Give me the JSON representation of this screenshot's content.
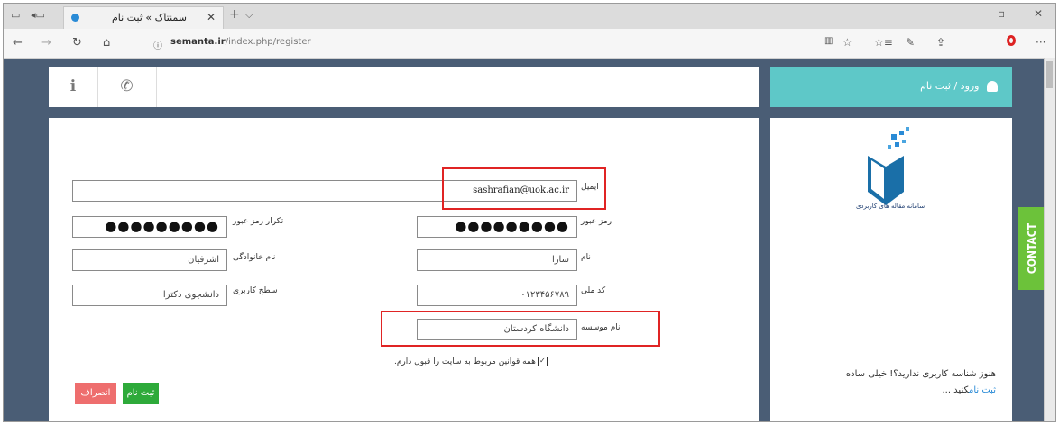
{
  "browser": {
    "tab_title": "سمنتاک » ثبت نام",
    "url_domain": "semanta.ir",
    "url_path": "/index.php/register"
  },
  "header": {
    "login_label": "ورود / ثبت نام"
  },
  "form": {
    "email_label": "ایمیل",
    "email_value": "sashrafian@uok.ac.ir",
    "password_label": "رمز عبور",
    "password_value": "●●●●●●●●●",
    "password_confirm_label": "تکرار رمز عبور",
    "password_confirm_value": "●●●●●●●●●",
    "first_name_label": "نام",
    "first_name_value": "سارا",
    "last_name_label": "نام خانوادگی",
    "last_name_value": "اشرفیان",
    "national_id_label": "کد ملی",
    "national_id_value": "۰۱۲۳۴۵۶۷۸۹",
    "user_level_label": "سطح کاربری",
    "user_level_value": "دانشجوی دکترا",
    "institution_label": "نام موسسه",
    "institution_value": "دانشگاه کردستان",
    "terms_label": "همه قوانین مربوط به سایت را قبول دارم.",
    "submit_label": "ثبت نام",
    "cancel_label": "انصراف"
  },
  "sidebar": {
    "logo_text": "سامانه مقاله های کاربردی",
    "prompt_text": "هنوز شناسه کاربری ندارید؟! خیلی ساده",
    "signup_link": "ثبت نام",
    "signup_suffix": "کنید ..."
  },
  "contact_label": "CONTACT"
}
